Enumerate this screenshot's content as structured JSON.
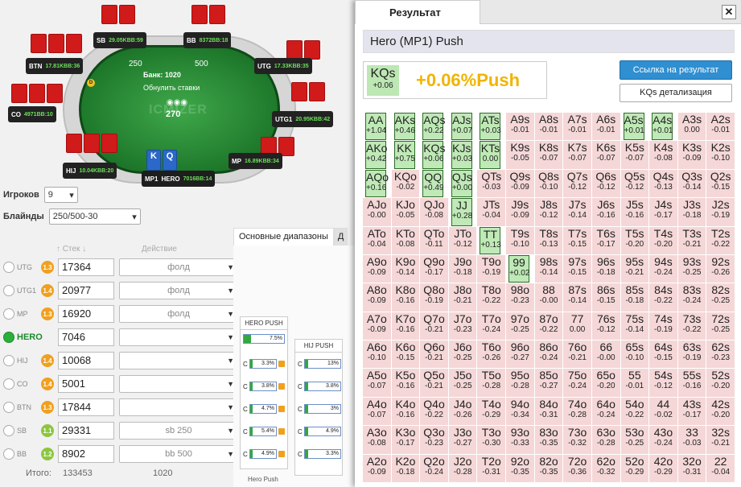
{
  "table": {
    "pot_label": "Банк: 1020",
    "reset_label": "Обнулить ставки",
    "logo": "ICMIZER",
    "center_chips": "270",
    "sb_chips": "250",
    "bb_chips": "500",
    "seats": [
      {
        "name": "SB",
        "stack": "29.05K",
        "bb": "BB:59"
      },
      {
        "name": "BB",
        "stack": "8372",
        "bb": "BB:18"
      },
      {
        "name": "UTG",
        "stack": "17.33K",
        "bb": "BB:35"
      },
      {
        "name": "UTG1",
        "stack": "20.95K",
        "bb": "BB:42"
      },
      {
        "name": "MP",
        "stack": "16.89K",
        "bb": "BB:34"
      },
      {
        "name": "HERO",
        "stack": "7016",
        "bb": "BB:14"
      },
      {
        "name": "HIJ",
        "stack": "10.04K",
        "bb": "BB:20"
      },
      {
        "name": "CO",
        "stack": "4971",
        "bb": "BB:10"
      },
      {
        "name": "BTN",
        "stack": "17.81K",
        "bb": "BB:36"
      }
    ],
    "hero_seat_label": "MP1",
    "hero_cards": [
      "K",
      "Q"
    ]
  },
  "settings": {
    "players_label": "Игроков",
    "players_value": "9",
    "blinds_label": "Блайнды",
    "blinds_value": "250/500-30"
  },
  "players_table": {
    "stack_header": "Стек",
    "action_header": "Действие",
    "rows": [
      {
        "pos": "UTG",
        "badge": "1.3",
        "stack": "17364",
        "action": "фолд"
      },
      {
        "pos": "UTG1",
        "badge": "1.4",
        "stack": "20977",
        "action": "фолд"
      },
      {
        "pos": "MP",
        "badge": "1.3",
        "stack": "16920",
        "action": "фолд"
      },
      {
        "pos": "HERO",
        "badge": "",
        "stack": "7046",
        "action": ""
      },
      {
        "pos": "HIJ",
        "badge": "1.4",
        "stack": "10068",
        "action": ""
      },
      {
        "pos": "CO",
        "badge": "1.4",
        "stack": "5001",
        "action": ""
      },
      {
        "pos": "BTN",
        "badge": "1.3",
        "stack": "17844",
        "action": ""
      },
      {
        "pos": "SB",
        "badge": "1.1",
        "stack": "29331",
        "action": "sb 250"
      },
      {
        "pos": "BB",
        "badge": "1.2",
        "stack": "8902",
        "action": "bb 500"
      }
    ],
    "totals_label": "Итого:",
    "total_stack": "133453",
    "total_action": "1020"
  },
  "ranges": {
    "tab_main": "Основные диапазоны",
    "tab_other": "Д",
    "hero_push_header": "HERO PUSH",
    "hero_push_value": "7.5%",
    "hij_push_header": "HIJ PUSH",
    "calls_col1": [
      "3.3%",
      "3.8%",
      "4.7%",
      "5.4%",
      "4.9%"
    ],
    "calls_col2": [
      "13%",
      "3.8%",
      "3%",
      "4.9%",
      "3.3%"
    ],
    "call_prefix": "C",
    "footer": "Hero Push"
  },
  "result": {
    "tab_label": "Результат",
    "close_label": "✕",
    "title": "Hero (MP1) Push",
    "hand": "KQs",
    "hand_ev": "+0.06",
    "headline": "+0.06%Push",
    "link_button": "Ссылка на результат",
    "detail_button": "KQs детализация"
  },
  "grid": [
    [
      [
        "AA",
        "+1.04",
        1
      ],
      [
        "AKs",
        "+0.46",
        1
      ],
      [
        "AQs",
        "+0.22",
        1
      ],
      [
        "AJs",
        "+0.07",
        1
      ],
      [
        "ATs",
        "+0.03",
        1
      ],
      [
        "A9s",
        "-0.01",
        0
      ],
      [
        "A8s",
        "-0.01",
        0
      ],
      [
        "A7s",
        "-0.01",
        0
      ],
      [
        "A6s",
        "-0.01",
        0
      ],
      [
        "A5s",
        "+0.01",
        1
      ],
      [
        "A4s",
        "+0.01",
        1
      ],
      [
        "A3s",
        "0.00",
        0
      ],
      [
        "A2s",
        "-0.01",
        0
      ]
    ],
    [
      [
        "AKo",
        "+0.42",
        1
      ],
      [
        "KK",
        "+0.75",
        1
      ],
      [
        "KQs",
        "+0.06",
        1
      ],
      [
        "KJs",
        "+0.03",
        1
      ],
      [
        "KTs",
        "0.00",
        1
      ],
      [
        "K9s",
        "-0.05",
        0
      ],
      [
        "K8s",
        "-0.07",
        0
      ],
      [
        "K7s",
        "-0.07",
        0
      ],
      [
        "K6s",
        "-0.07",
        0
      ],
      [
        "K5s",
        "-0.07",
        0
      ],
      [
        "K4s",
        "-0.08",
        0
      ],
      [
        "K3s",
        "-0.09",
        0
      ],
      [
        "K2s",
        "-0.10",
        0
      ]
    ],
    [
      [
        "AQo",
        "+0.16",
        1
      ],
      [
        "KQo",
        "-0.02",
        0
      ],
      [
        "QQ",
        "+0.49",
        1
      ],
      [
        "QJs",
        "+0.00",
        1
      ],
      [
        "QTs",
        "-0.03",
        0
      ],
      [
        "Q9s",
        "-0.09",
        0
      ],
      [
        "Q8s",
        "-0.10",
        0
      ],
      [
        "Q7s",
        "-0.12",
        0
      ],
      [
        "Q6s",
        "-0.12",
        0
      ],
      [
        "Q5s",
        "-0.12",
        0
      ],
      [
        "Q4s",
        "-0.13",
        0
      ],
      [
        "Q3s",
        "-0.14",
        0
      ],
      [
        "Q2s",
        "-0.15",
        0
      ]
    ],
    [
      [
        "AJo",
        "-0.00",
        0
      ],
      [
        "KJo",
        "-0.05",
        0
      ],
      [
        "QJo",
        "-0.08",
        0
      ],
      [
        "JJ",
        "+0.28",
        1
      ],
      [
        "JTs",
        "-0.04",
        0
      ],
      [
        "J9s",
        "-0.09",
        0
      ],
      [
        "J8s",
        "-0.12",
        0
      ],
      [
        "J7s",
        "-0.14",
        0
      ],
      [
        "J6s",
        "-0.16",
        0
      ],
      [
        "J5s",
        "-0.16",
        0
      ],
      [
        "J4s",
        "-0.17",
        0
      ],
      [
        "J3s",
        "-0.18",
        0
      ],
      [
        "J2s",
        "-0.19",
        0
      ]
    ],
    [
      [
        "ATo",
        "-0.04",
        0
      ],
      [
        "KTo",
        "-0.08",
        0
      ],
      [
        "QTo",
        "-0.11",
        0
      ],
      [
        "JTo",
        "-0.12",
        0
      ],
      [
        "TT",
        "+0.13",
        1
      ],
      [
        "T9s",
        "-0.10",
        0
      ],
      [
        "T8s",
        "-0.13",
        0
      ],
      [
        "T7s",
        "-0.15",
        0
      ],
      [
        "T6s",
        "-0.17",
        0
      ],
      [
        "T5s",
        "-0.20",
        0
      ],
      [
        "T4s",
        "-0.20",
        0
      ],
      [
        "T3s",
        "-0.21",
        0
      ],
      [
        "T2s",
        "-0.22",
        0
      ]
    ],
    [
      [
        "A9o",
        "-0.09",
        0
      ],
      [
        "K9o",
        "-0.14",
        0
      ],
      [
        "Q9o",
        "-0.17",
        0
      ],
      [
        "J9o",
        "-0.18",
        0
      ],
      [
        "T9o",
        "-0.19",
        0
      ],
      [
        "99",
        "+0.02",
        1
      ],
      [
        "98s",
        "-0.14",
        0
      ],
      [
        "97s",
        "-0.15",
        0
      ],
      [
        "96s",
        "-0.18",
        0
      ],
      [
        "95s",
        "-0.21",
        0
      ],
      [
        "94s",
        "-0.24",
        0
      ],
      [
        "93s",
        "-0.25",
        0
      ],
      [
        "92s",
        "-0.26",
        0
      ]
    ],
    [
      [
        "A8o",
        "-0.09",
        0
      ],
      [
        "K8o",
        "-0.16",
        0
      ],
      [
        "Q8o",
        "-0.19",
        0
      ],
      [
        "J8o",
        "-0.21",
        0
      ],
      [
        "T8o",
        "-0.22",
        0
      ],
      [
        "98o",
        "-0.23",
        0
      ],
      [
        "88",
        "-0.00",
        0
      ],
      [
        "87s",
        "-0.14",
        0
      ],
      [
        "86s",
        "-0.15",
        0
      ],
      [
        "85s",
        "-0.18",
        0
      ],
      [
        "84s",
        "-0.22",
        0
      ],
      [
        "83s",
        "-0.24",
        0
      ],
      [
        "82s",
        "-0.25",
        0
      ]
    ],
    [
      [
        "A7o",
        "-0.09",
        0
      ],
      [
        "K7o",
        "-0.16",
        0
      ],
      [
        "Q7o",
        "-0.21",
        0
      ],
      [
        "J7o",
        "-0.23",
        0
      ],
      [
        "T7o",
        "-0.24",
        0
      ],
      [
        "97o",
        "-0.25",
        0
      ],
      [
        "87o",
        "-0.22",
        0
      ],
      [
        "77",
        "0.00",
        0
      ],
      [
        "76s",
        "-0.12",
        0
      ],
      [
        "75s",
        "-0.14",
        0
      ],
      [
        "74s",
        "-0.19",
        0
      ],
      [
        "73s",
        "-0.22",
        0
      ],
      [
        "72s",
        "-0.25",
        0
      ]
    ],
    [
      [
        "A6o",
        "-0.10",
        0
      ],
      [
        "K6o",
        "-0.15",
        0
      ],
      [
        "Q6o",
        "-0.21",
        0
      ],
      [
        "J6o",
        "-0.25",
        0
      ],
      [
        "T6o",
        "-0.26",
        0
      ],
      [
        "96o",
        "-0.27",
        0
      ],
      [
        "86o",
        "-0.24",
        0
      ],
      [
        "76o",
        "-0.21",
        0
      ],
      [
        "66",
        "-0.00",
        0
      ],
      [
        "65s",
        "-0.10",
        0
      ],
      [
        "64s",
        "-0.15",
        0
      ],
      [
        "63s",
        "-0.19",
        0
      ],
      [
        "62s",
        "-0.23",
        0
      ]
    ],
    [
      [
        "A5o",
        "-0.07",
        0
      ],
      [
        "K5o",
        "-0.16",
        0
      ],
      [
        "Q5o",
        "-0.21",
        0
      ],
      [
        "J5o",
        "-0.25",
        0
      ],
      [
        "T5o",
        "-0.28",
        0
      ],
      [
        "95o",
        "-0.28",
        0
      ],
      [
        "85o",
        "-0.27",
        0
      ],
      [
        "75o",
        "-0.24",
        0
      ],
      [
        "65o",
        "-0.20",
        0
      ],
      [
        "55",
        "-0.01",
        0
      ],
      [
        "54s",
        "-0.12",
        0
      ],
      [
        "55s",
        "-0.16",
        0
      ],
      [
        "52s",
        "-0.20",
        0
      ]
    ],
    [
      [
        "A4o",
        "-0.07",
        0
      ],
      [
        "K4o",
        "-0.16",
        0
      ],
      [
        "Q4o",
        "-0.22",
        0
      ],
      [
        "J4o",
        "-0.26",
        0
      ],
      [
        "T4o",
        "-0.29",
        0
      ],
      [
        "94o",
        "-0.34",
        0
      ],
      [
        "84o",
        "-0.31",
        0
      ],
      [
        "74o",
        "-0.28",
        0
      ],
      [
        "64o",
        "-0.24",
        0
      ],
      [
        "54o",
        "-0.22",
        0
      ],
      [
        "44",
        "-0.02",
        0
      ],
      [
        "43s",
        "-0.17",
        0
      ],
      [
        "42s",
        "-0.20",
        0
      ]
    ],
    [
      [
        "A3o",
        "-0.08",
        0
      ],
      [
        "K3o",
        "-0.17",
        0
      ],
      [
        "Q3o",
        "-0.23",
        0
      ],
      [
        "J3o",
        "-0.27",
        0
      ],
      [
        "T3o",
        "-0.30",
        0
      ],
      [
        "93o",
        "-0.33",
        0
      ],
      [
        "83o",
        "-0.35",
        0
      ],
      [
        "73o",
        "-0.32",
        0
      ],
      [
        "63o",
        "-0.28",
        0
      ],
      [
        "53o",
        "-0.25",
        0
      ],
      [
        "43o",
        "-0.24",
        0
      ],
      [
        "33",
        "-0.03",
        0
      ],
      [
        "32s",
        "-0.21",
        0
      ]
    ],
    [
      [
        "A2o",
        "-0.09",
        0
      ],
      [
        "K2o",
        "-0.18",
        0
      ],
      [
        "Q2o",
        "-0.24",
        0
      ],
      [
        "J2o",
        "-0.28",
        0
      ],
      [
        "T2o",
        "-0.31",
        0
      ],
      [
        "92o",
        "-0.35",
        0
      ],
      [
        "82o",
        "-0.35",
        0
      ],
      [
        "72o",
        "-0.36",
        0
      ],
      [
        "62o",
        "-0.32",
        0
      ],
      [
        "52o",
        "-0.29",
        0
      ],
      [
        "42o",
        "-0.29",
        0
      ],
      [
        "32o",
        "-0.31",
        0
      ],
      [
        "22",
        "-0.04",
        0
      ]
    ]
  ]
}
